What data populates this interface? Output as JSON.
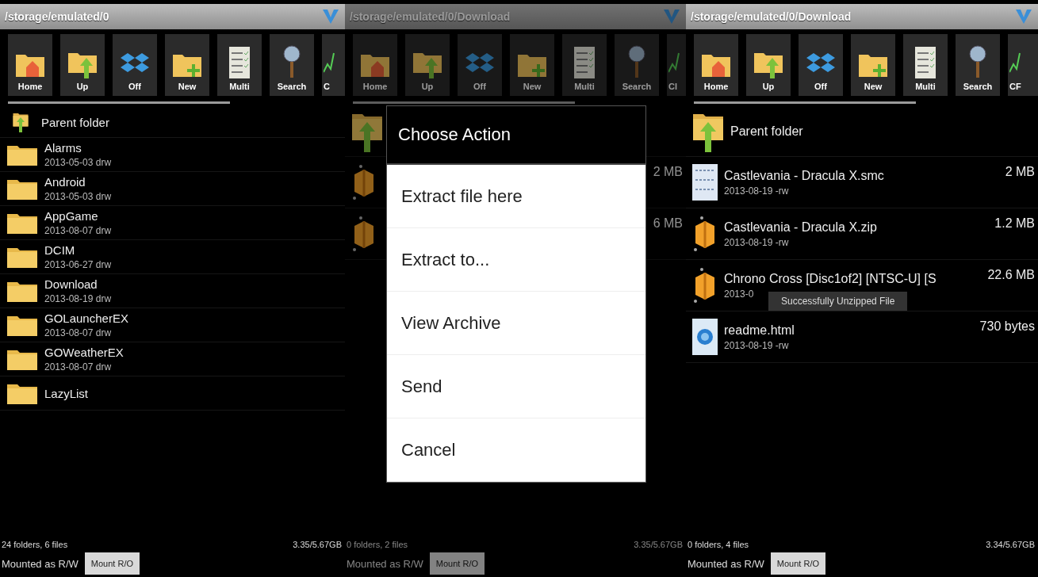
{
  "panels": [
    {
      "path": "/storage/emulated/0",
      "dimmed": false,
      "toolbar": [
        {
          "label": "Home",
          "kind": "home"
        },
        {
          "label": "Up",
          "kind": "up"
        },
        {
          "label": "Off",
          "kind": "box"
        },
        {
          "label": "New",
          "kind": "new"
        },
        {
          "label": "Multi",
          "kind": "multi"
        },
        {
          "label": "Search",
          "kind": "search"
        },
        {
          "label": "C",
          "kind": "chart"
        }
      ],
      "items": [
        {
          "kind": "parent",
          "name": "Parent folder"
        },
        {
          "kind": "folder",
          "name": "Alarms",
          "meta": "2013-05-03 drw"
        },
        {
          "kind": "folder",
          "name": "Android",
          "meta": "2013-05-03 drw"
        },
        {
          "kind": "folder",
          "name": "AppGame",
          "meta": "2013-08-07 drw"
        },
        {
          "kind": "folder",
          "name": "DCIM",
          "meta": "2013-06-27 drw"
        },
        {
          "kind": "folder",
          "name": "Download",
          "meta": "2013-08-19 drw"
        },
        {
          "kind": "folder",
          "name": "GOLauncherEX",
          "meta": "2013-08-07 drw"
        },
        {
          "kind": "folder",
          "name": "GOWeatherEX",
          "meta": "2013-08-07 drw"
        },
        {
          "kind": "folder",
          "name": "LazyList"
        }
      ],
      "counts": "24 folders, 6 files",
      "storage": "3.35/5.67GB",
      "mount_state": "Mounted as R/W",
      "mount_button": "Mount R/O"
    },
    {
      "path": "/storage/emulated/0/Download",
      "dimmed": true,
      "toolbar": [
        {
          "label": "Home",
          "kind": "home"
        },
        {
          "label": "Up",
          "kind": "up"
        },
        {
          "label": "Off",
          "kind": "box"
        },
        {
          "label": "New",
          "kind": "new"
        },
        {
          "label": "Multi",
          "kind": "multi"
        },
        {
          "label": "Search",
          "kind": "search"
        },
        {
          "label": "Cl",
          "kind": "chart"
        }
      ],
      "items": [
        {
          "kind": "parent"
        },
        {
          "kind": "archive",
          "size": "2 MB"
        },
        {
          "kind": "archive",
          "size": "6 MB"
        }
      ],
      "counts": "0 folders, 2 files",
      "storage": "3.35/5.67GB",
      "mount_state": "Mounted as R/W",
      "mount_button": "Mount R/O",
      "dialog": {
        "title": "Choose Action",
        "options": [
          "Extract file here",
          "Extract to...",
          "View Archive",
          "Send",
          "Cancel"
        ]
      }
    },
    {
      "path": "/storage/emulated/0/Download",
      "dimmed": false,
      "toolbar": [
        {
          "label": "Home",
          "kind": "home"
        },
        {
          "label": "Up",
          "kind": "up"
        },
        {
          "label": "Off",
          "kind": "box"
        },
        {
          "label": "New",
          "kind": "new"
        },
        {
          "label": "Multi",
          "kind": "multi"
        },
        {
          "label": "Search",
          "kind": "search"
        },
        {
          "label": "CF",
          "kind": "chart"
        }
      ],
      "items": [
        {
          "kind": "parent",
          "name": "Parent folder"
        },
        {
          "kind": "rom",
          "name": "Castlevania - Dracula X.smc",
          "meta": "2013-08-19 -rw",
          "size": "2 MB"
        },
        {
          "kind": "archive",
          "name": "Castlevania - Dracula X.zip",
          "meta": "2013-08-19 -rw",
          "size": "1.2 MB"
        },
        {
          "kind": "archive",
          "name": "Chrono Cross [Disc1of2] [NTSC-U] [S",
          "meta": "2013-0",
          "size": "22.6 MB",
          "toast": "Successfully Unzipped File"
        },
        {
          "kind": "web",
          "name": "readme.html",
          "meta": "2013-08-19 -rw",
          "size": "730 bytes"
        }
      ],
      "counts": "0 folders, 4 files",
      "storage": "3.34/5.67GB",
      "mount_state": "Mounted as R/W",
      "mount_button": "Mount R/O"
    }
  ]
}
